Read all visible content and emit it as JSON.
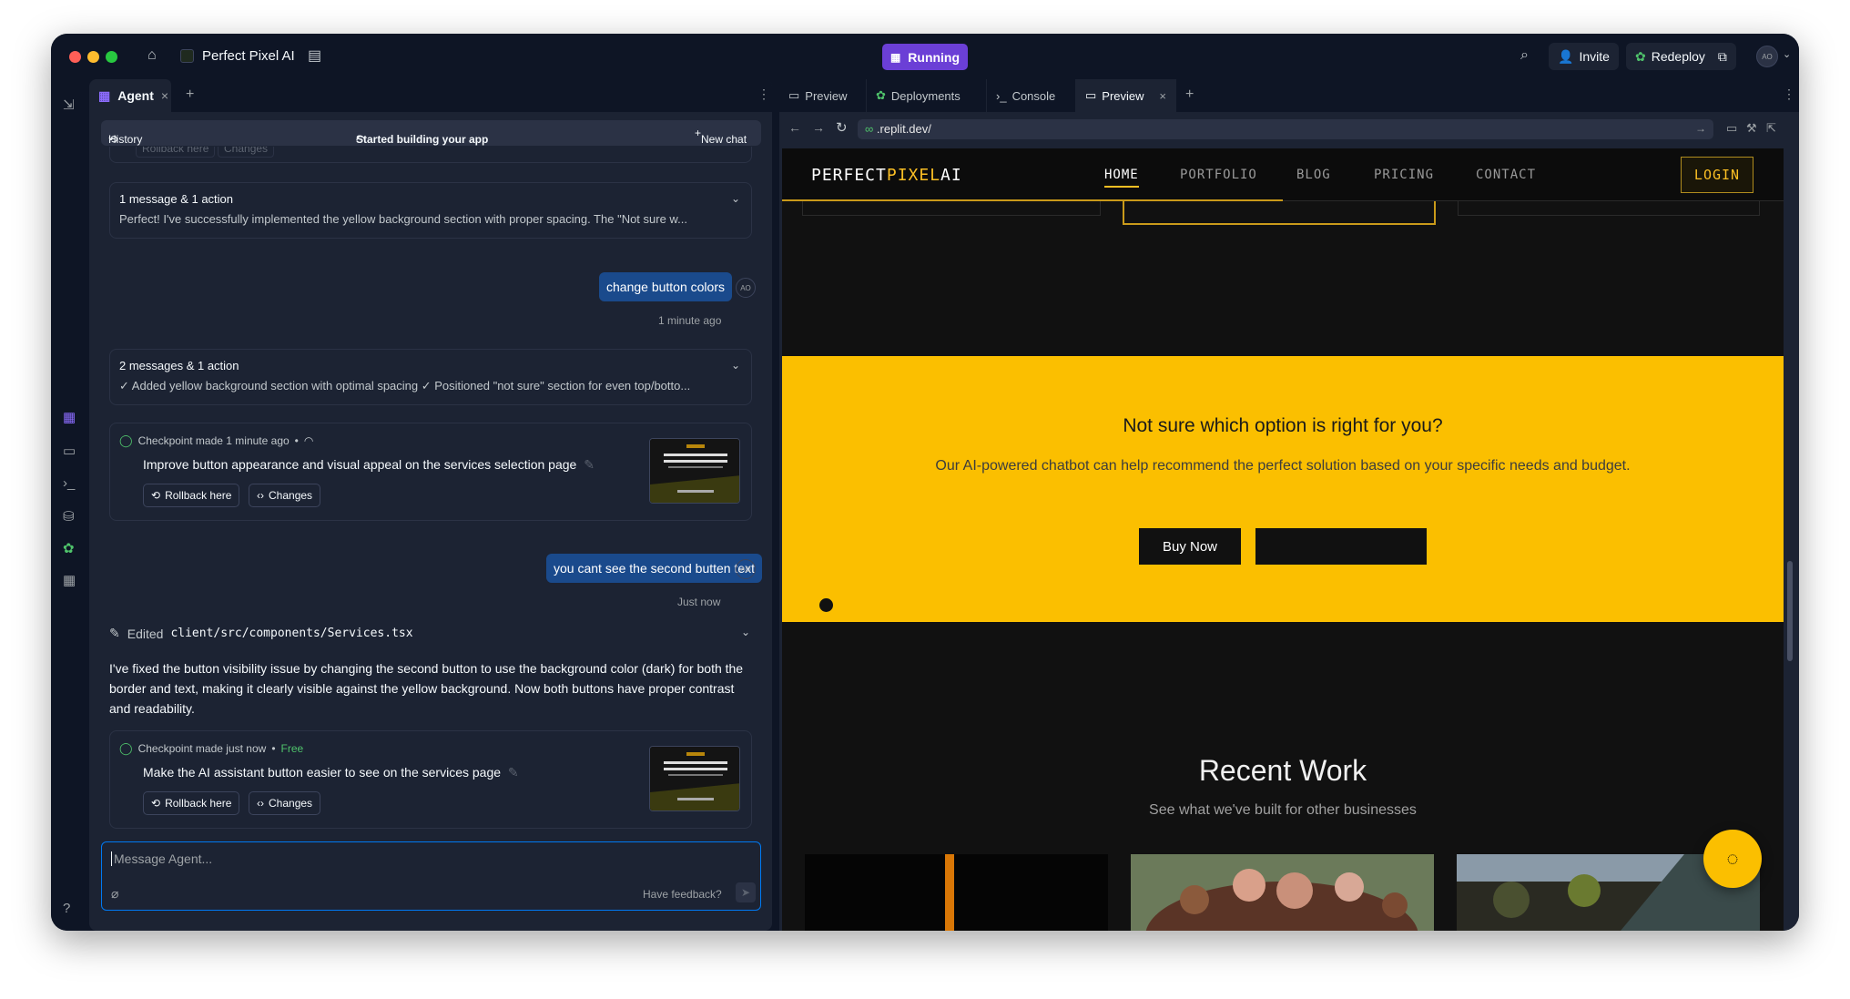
{
  "titlebar": {
    "app_name": "Perfect Pixel AI",
    "status": "Running",
    "invite": "Invite",
    "redeploy": "Redeploy",
    "avatar": "AO"
  },
  "agent": {
    "tab_label": "Agent",
    "history": "History",
    "subtitle": "Started building your app",
    "new_chat": "New chat",
    "partial_top": {
      "rollback": "Rollback here",
      "changes": "Changes"
    },
    "group1": {
      "title": "1 message & 1 action",
      "summary": "Perfect! I've successfully implemented the yellow background section with proper spacing. The \"Not sure w..."
    },
    "user_msg1": {
      "text": "change button colors",
      "time": "1 minute ago",
      "avatar": "AO"
    },
    "group2": {
      "title": "2 messages & 1 action",
      "summary": "✓ Added yellow background section with optimal spacing ✓ Positioned \"not sure\" section for even top/botto..."
    },
    "checkpoint1": {
      "head": "Checkpoint made 1 minute ago",
      "title": "Improve button appearance and visual appeal on the services selection page",
      "rollback": "Rollback here",
      "changes": "Changes"
    },
    "user_msg2": {
      "text": "you cant see the second butten text",
      "time": "Just now",
      "avatar": "AO"
    },
    "edited": {
      "label": "Edited",
      "path": "client/src/components/Services.tsx"
    },
    "response": "I've fixed the button visibility issue by changing the second button to use the background color (dark) for both the border and text, making it clearly visible against the yellow background. Now both buttons have proper contrast and readability.",
    "checkpoint2": {
      "head": "Checkpoint made just now",
      "free": "Free",
      "title": "Make the AI assistant button easier to see on the services page",
      "rollback": "Rollback here",
      "changes": "Changes"
    },
    "input": {
      "placeholder": "Message Agent...",
      "feedback": "Have feedback?"
    }
  },
  "right_tabs": [
    "Preview",
    "Deployments",
    "Console",
    "Preview"
  ],
  "url": ".replit.dev/",
  "site": {
    "logo_a": "PERFECT",
    "logo_b": "PIXEL",
    "logo_c": "AI",
    "nav": [
      "HOME",
      "PORTFOLIO",
      "BLOG",
      "PRICING",
      "CONTACT"
    ],
    "login": "LOGIN",
    "cta_title": "Not sure which option is right for you?",
    "cta_sub": "Our AI-powered chatbot can help recommend the perfect solution based on your specific needs and budget.",
    "buy_now": "Buy Now",
    "recent_title": "Recent Work",
    "recent_sub": "See what we've built for other businesses"
  },
  "colors": {
    "accent_yellow": "#fbbf00",
    "user_bubble": "#1a4a8c",
    "running": "#6b3fd6",
    "focus_blue": "#0079f2"
  }
}
